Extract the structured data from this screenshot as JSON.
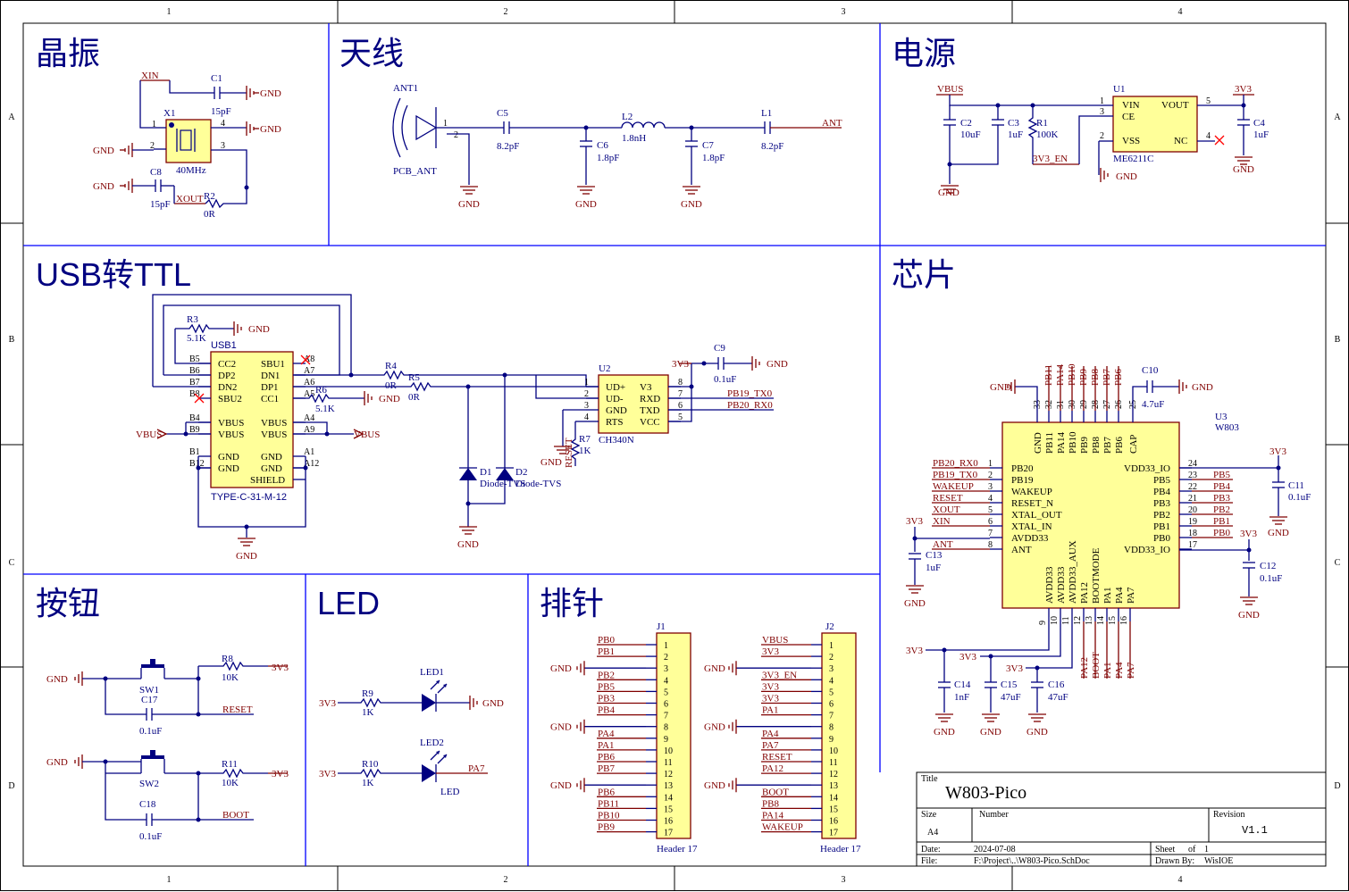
{
  "frame": {
    "columns": [
      "1",
      "2",
      "3",
      "4"
    ],
    "rows": [
      "A",
      "B",
      "C",
      "D"
    ]
  },
  "sections": {
    "crystal": "晶振",
    "antenna": "天线",
    "power": "电源",
    "usb_ttl": "USB转TTL",
    "chip": "芯片",
    "button": "按钮",
    "led": "LED",
    "header": "排针"
  },
  "crystal": {
    "xin": "XIN",
    "xout": "XOUT",
    "c1": "C1",
    "c1v": "15pF",
    "c8": "C8",
    "c8v": "15pF",
    "x1": "X1",
    "x1v": "40MHz",
    "r2": "R2",
    "r2v": "0R",
    "gnd": "GND",
    "p1": "1",
    "p2": "2",
    "p3": "3",
    "p4": "4"
  },
  "antenna": {
    "ant1": "ANT1",
    "pcb_ant": "PCB_ANT",
    "c5": "C5",
    "c5v": "8.2pF",
    "c6": "C6",
    "c6v": "1.8pF",
    "l2": "L2",
    "l2v": "1.8nH",
    "c7": "C7",
    "c7v": "1.8pF",
    "l1": "L1",
    "l1v": "8.2pF",
    "ant": "ANT",
    "gnd": "GND",
    "p1": "1",
    "p2": "2"
  },
  "power": {
    "vbus": "VBUS",
    "c2": "C2",
    "c2v": "10uF",
    "c3": "C3",
    "c3v": "1uF",
    "r1": "R1",
    "r1v": "100K",
    "u1": "U1",
    "u1v": "ME6211C",
    "vin": "VIN",
    "ce": "CE",
    "vss": "VSS",
    "vout": "VOUT",
    "nc": "NC",
    "v33": "3V3",
    "c4": "C4",
    "c4v": "1uF",
    "en": "3V3_EN",
    "gnd": "GND",
    "p1": "1",
    "p2": "2",
    "p3": "3",
    "p4": "4",
    "p5": "5"
  },
  "usb": {
    "r3": "R3",
    "r3v": "5.1K",
    "usb1": "USB1",
    "part": "TYPE-C-31-M-12",
    "gnd": "GND",
    "vbus": "VBUS",
    "left_pins": [
      "B5",
      "B6",
      "B7",
      "B8",
      "B4",
      "B9",
      "B1",
      "B12"
    ],
    "left_names": [
      "CC2",
      "DP2",
      "DN2",
      "SBU2",
      "VBUS",
      "VBUS",
      "GND",
      "GND"
    ],
    "right_pins": [
      "A8",
      "A7",
      "A6",
      "A5",
      "A4",
      "A9",
      "A1",
      "A12"
    ],
    "right_names": [
      "SBU1",
      "DN1",
      "DP1",
      "CC1",
      "VBUS",
      "VBUS",
      "GND",
      "GND"
    ],
    "shield": "SHIELD",
    "r4": "R4",
    "r4v": "0R",
    "r5": "R5",
    "r5v": "0R",
    "r6": "R6",
    "r6v": "5.1K",
    "d1": "D1",
    "d1v": "Diode-TVS",
    "d2": "D2",
    "d2v": "Diode-TVS",
    "u2": "U2",
    "u2v": "CH340N",
    "c9": "C9",
    "c9v": "0.1uF",
    "v33": "3V3",
    "r7": "R7",
    "r7v": "1K",
    "reset": "RESET",
    "u2_left": [
      "UD+",
      "UD-",
      "GND",
      "RTS"
    ],
    "u2_lnums": [
      "1",
      "2",
      "3",
      "4"
    ],
    "u2_right": [
      "V3",
      "RXD",
      "TXD",
      "VCC"
    ],
    "u2_rnums": [
      "8",
      "7",
      "6",
      "5"
    ],
    "tx": "PB19_TX0",
    "rx": "PB20_RX0"
  },
  "chip": {
    "u3": "U3",
    "u3v": "W803",
    "c10": "C10",
    "c10v": "4.7uF",
    "gnd": "GND",
    "v33": "3V3",
    "top_names": [
      "GND",
      "PB11",
      "PA14",
      "PB10",
      "PB9",
      "PB8",
      "PB7",
      "PB6",
      "CAP"
    ],
    "top_nums": [
      "33",
      "32",
      "31",
      "30",
      "29",
      "28",
      "27",
      "26",
      "25"
    ],
    "top_nets": [
      "PB11",
      "PA14",
      "PB10",
      "PB9",
      "PB8",
      "PB7",
      "PB6"
    ],
    "left_names": [
      "PB20",
      "PB19",
      "WAKEUP",
      "RESET_N",
      "XTAL_OUT",
      "XTAL_IN",
      "AVDD33",
      "ANT"
    ],
    "left_nums": [
      "1",
      "2",
      "3",
      "4",
      "5",
      "6",
      "7",
      "8"
    ],
    "left_nets": [
      "PB20_RX0",
      "PB19_TX0",
      "WAKEUP",
      "RESET",
      "XOUT",
      "XIN",
      "",
      "ANT"
    ],
    "right_names": [
      "VDD33_IO",
      "PB5",
      "PB4",
      "PB3",
      "PB2",
      "PB1",
      "PB0",
      "VDD33_IO"
    ],
    "right_nums": [
      "24",
      "23",
      "22",
      "21",
      "20",
      "19",
      "18",
      "17"
    ],
    "right_nets": [
      "PB5",
      "PB4",
      "PB3",
      "PB2",
      "PB1",
      "PB0"
    ],
    "bottom_names": [
      "AVDD33",
      "AVDD33",
      "AVDD33_AUX",
      "PA12",
      "BOOTMODE",
      "PA1",
      "PA4",
      "PA7"
    ],
    "bottom_nums": [
      "9",
      "10",
      "11",
      "12",
      "13",
      "14",
      "15",
      "16"
    ],
    "bottom_nets": [
      "PA12",
      "BOOT",
      "PA1",
      "PA4",
      "PA7"
    ],
    "c11": "C11",
    "c11v": "0.1uF",
    "c12": "C12",
    "c12v": "0.1uF",
    "c13": "C13",
    "c13v": "1uF",
    "c14": "C14",
    "c14v": "1nF",
    "c15": "C15",
    "c15v": "47uF",
    "c16": "C16",
    "c16v": "47uF"
  },
  "button": {
    "sw1": "SW1",
    "sw2": "SW2",
    "r8": "R8",
    "r8v": "10K",
    "r11": "R11",
    "r11v": "10K",
    "c17": "C17",
    "c17v": "0.1uF",
    "c18": "C18",
    "c18v": "0.1uF",
    "reset": "RESET",
    "boot": "BOOT",
    "gnd": "GND",
    "v33": "3V3"
  },
  "led": {
    "led1": "LED1",
    "led2": "LED2",
    "led2v": "LED",
    "r9": "R9",
    "r9v": "1K",
    "r10": "R10",
    "r10v": "1K",
    "v33": "3V3",
    "gnd": "GND",
    "pa7": "PA7"
  },
  "headers": {
    "j1": "J1",
    "j2": "J2",
    "part": "Header 17",
    "gnd": "GND",
    "nums": [
      "1",
      "2",
      "3",
      "4",
      "5",
      "6",
      "7",
      "8",
      "9",
      "10",
      "11",
      "12",
      "13",
      "14",
      "15",
      "16",
      "17"
    ],
    "j1_nets": [
      "PB0",
      "PB1",
      "",
      "PB2",
      "PB5",
      "PB3",
      "PB4",
      "",
      "PA4",
      "PA1",
      "PB6",
      "PB7",
      "",
      "PB6",
      "PB11",
      "PB10",
      "PB9"
    ],
    "j2_nets": [
      "VBUS",
      "3V3",
      "",
      "3V3_EN",
      "3V3",
      "3V3",
      "PA1",
      "",
      "PA4",
      "PA7",
      "RESET",
      "PA12",
      "",
      "BOOT",
      "PB8",
      "PA14",
      "WAKEUP"
    ]
  },
  "titleblock": {
    "title_label": "Title",
    "title": "W803-Pico",
    "size_label": "Size",
    "size": "A4",
    "number_label": "Number",
    "revision_label": "Revision",
    "revision": "V1.1",
    "date_label": "Date:",
    "date": "2024-07-08",
    "sheet_label": "Sheet",
    "of_label": "of",
    "sheet_total": "1",
    "file_label": "File:",
    "file": "F:\\Project\\..\\W803-Pico.SchDoc",
    "drawn_label": "Drawn By:",
    "drawn": "WisIOE"
  }
}
